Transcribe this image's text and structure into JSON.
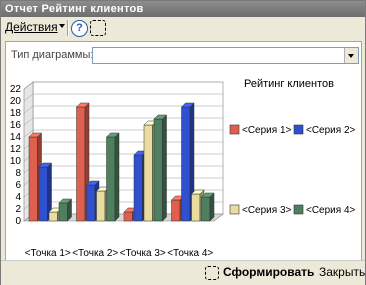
{
  "window": {
    "title": "Отчет  Рейтинг клиентов"
  },
  "toolbar": {
    "actions_label": "Действия",
    "help_label": "?"
  },
  "form": {
    "chart_type_label": "Тип диаграммы:",
    "chart_type_value": ""
  },
  "buttons": {
    "generate_label": "Сформировать",
    "close_label": "Закрыть"
  },
  "colors": {
    "series1": "#e06050",
    "series2": "#3050d0",
    "series3": "#e8dca0",
    "series4": "#4f7f5f"
  },
  "chart_data": {
    "type": "bar",
    "title": "Рейтинг клиентов",
    "categories": [
      "<Точка 1>",
      "<Точка 2>",
      "<Точка 3>",
      "<Точка 4>"
    ],
    "series": [
      {
        "name": "<Серия 1>",
        "values": [
          14,
          19,
          1.5,
          3.5
        ]
      },
      {
        "name": "<Серия 2>",
        "values": [
          9,
          6,
          11,
          19
        ]
      },
      {
        "name": "<Серия 3>",
        "values": [
          1.5,
          5,
          16,
          4.5
        ]
      },
      {
        "name": "<Серия 4>",
        "values": [
          3,
          14,
          17,
          4
        ]
      }
    ],
    "ylim": [
      0,
      22
    ],
    "yticks": [
      "0",
      "2",
      "4",
      "6",
      "8",
      "10",
      "12",
      "14",
      "16",
      "18",
      "20",
      "22"
    ],
    "grid": true,
    "legend": "right"
  }
}
